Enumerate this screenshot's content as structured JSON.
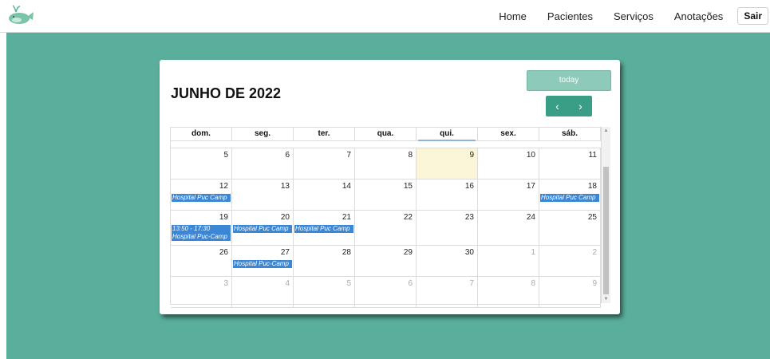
{
  "nav": {
    "home": "Home",
    "pacientes": "Pacientes",
    "servicos": "Serviços",
    "anotacoes": "Anotações",
    "sair": "Sair"
  },
  "calendar": {
    "title": "JUNHO DE 2022",
    "today_label": "today",
    "prev": "‹",
    "next": "›",
    "days_of_week": [
      "dom.",
      "seg.",
      "ter.",
      "qua.",
      "qui.",
      "sex.",
      "sáb."
    ],
    "weeks": [
      {
        "days": [
          {
            "num": "5",
            "events": []
          },
          {
            "num": "6",
            "events": []
          },
          {
            "num": "7",
            "events": []
          },
          {
            "num": "8",
            "events": []
          },
          {
            "num": "9",
            "events": []
          },
          {
            "num": "10",
            "events": []
          },
          {
            "num": "11",
            "events": []
          }
        ]
      },
      {
        "days": [
          {
            "num": "12",
            "events": [
              "Hospital Puc Camp"
            ]
          },
          {
            "num": "13",
            "events": []
          },
          {
            "num": "14",
            "events": []
          },
          {
            "num": "15",
            "events": []
          },
          {
            "num": "16",
            "events": []
          },
          {
            "num": "17",
            "events": []
          },
          {
            "num": "18",
            "events": [
              "Hospital Puc Camp"
            ]
          }
        ]
      },
      {
        "days": [
          {
            "num": "19",
            "events": [
              "13:50 - 17:30",
              "Hospital Puc-Camp"
            ]
          },
          {
            "num": "20",
            "events": [
              "Hospital Puc Camp"
            ]
          },
          {
            "num": "21",
            "events": [
              "Hospital Puc Camp"
            ]
          },
          {
            "num": "22",
            "events": []
          },
          {
            "num": "23",
            "events": []
          },
          {
            "num": "24",
            "events": []
          },
          {
            "num": "25",
            "events": []
          }
        ]
      },
      {
        "days": [
          {
            "num": "26",
            "events": []
          },
          {
            "num": "27",
            "events": [
              "Hospital Puc-Camp"
            ]
          },
          {
            "num": "28",
            "events": []
          },
          {
            "num": "29",
            "events": []
          },
          {
            "num": "30",
            "events": []
          },
          {
            "num": "1",
            "events": []
          },
          {
            "num": "2",
            "events": []
          }
        ]
      },
      {
        "days": [
          {
            "num": "3",
            "events": []
          },
          {
            "num": "4",
            "events": []
          },
          {
            "num": "5",
            "events": []
          },
          {
            "num": "6",
            "events": []
          },
          {
            "num": "7",
            "events": []
          },
          {
            "num": "8",
            "events": []
          },
          {
            "num": "9",
            "events": []
          }
        ]
      }
    ]
  },
  "colors": {
    "teal_bg": "#5aaf9c",
    "event_blue": "#3b87d6",
    "today_highlight": "#fcf6d8",
    "today_button": "#8ecab9",
    "nav_buttons": "#3a9d85"
  },
  "icons": {
    "logo": "whale-logo-icon"
  }
}
